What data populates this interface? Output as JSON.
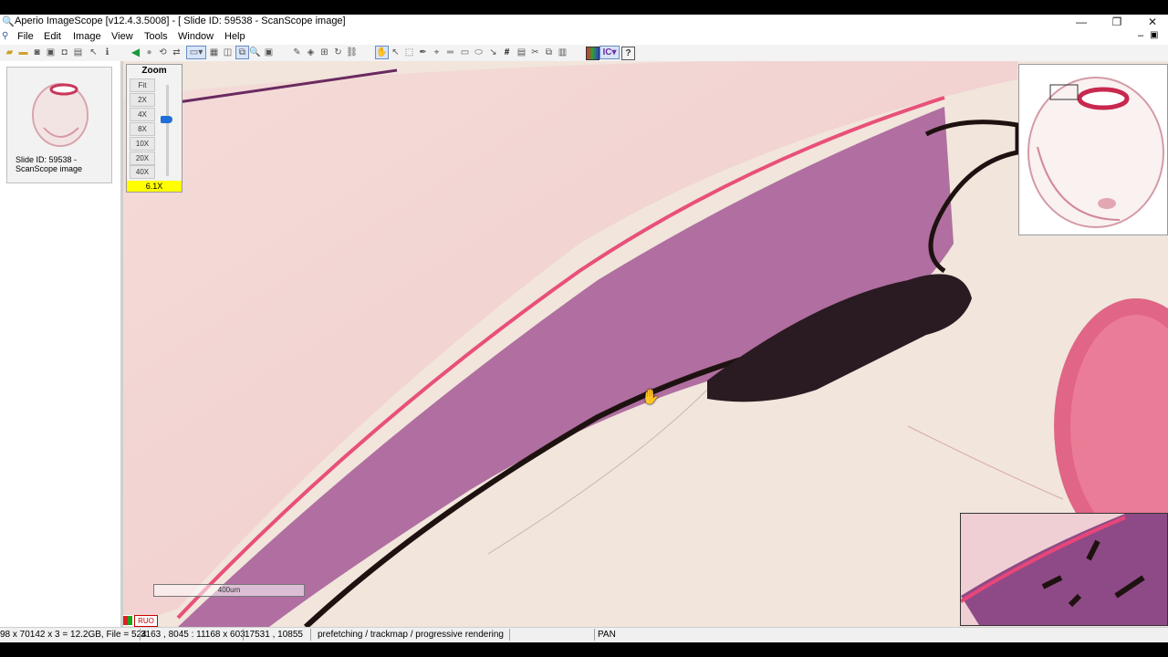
{
  "window": {
    "title": "Aperio ImageScope [v12.4.3.5008] - [ Slide ID: 59538 - ScanScope image]",
    "minimize": "—",
    "maximize": "❐",
    "close": "✕",
    "child_minimize": "–",
    "child_restore": "▣",
    "child_close": "✕"
  },
  "menu": [
    "File",
    "Edit",
    "Image",
    "View",
    "Tools",
    "Window",
    "Help"
  ],
  "toolbar_icons": [
    "open-icon",
    "folder-icon",
    "camera-icon",
    "save-icon",
    "export-icon",
    "network-icon",
    "arrow-icon",
    "info-icon",
    "back-icon",
    "forward-icon",
    "rotate-icon",
    "flip-icon",
    "select-dropdown-icon",
    "stack-icon",
    "split-icon",
    "sync-icon",
    "magnify-icon",
    "overview-icon",
    "annotation-pen-icon",
    "layers-icon",
    "filter-icon",
    "refresh-icon",
    "link-icon",
    "hand-pan-icon",
    "select-arrow-icon",
    "region-icon",
    "pen-icon",
    "measure-icon",
    "ruler-icon",
    "rectangle-icon",
    "ellipse-icon",
    "arrow-draw-icon",
    "grid-hash-icon",
    "table-icon",
    "cut-icon",
    "copy-icon",
    "paste-icon",
    "color-icon",
    "color-dropdown-icon",
    "help-icon"
  ],
  "left_panel": {
    "thumbnail_label": "Slide ID: 59538 - ScanScope image"
  },
  "zoom": {
    "title": "Zoom",
    "levels": [
      "Fit",
      "2X",
      "4X",
      "8X",
      "10X",
      "20X",
      "40X"
    ],
    "current": "6.1X"
  },
  "scale_bar": "400um",
  "ruo_label": "RUO",
  "status": {
    "dimensions": "98 x 70142 x 3 = 12.2GB, File = 524",
    "coords": "3163 , 8045 : 11168 x 603",
    "coords2": "17531 , 10855",
    "rendering": "prefetching / trackmap / progressive rendering",
    "mode": "PAN"
  },
  "colors": {
    "tissue_pink": "#e2708a",
    "stroma": "#8a3f7a",
    "pigment": "#1e1210",
    "background": "#f0e3d9",
    "zoom_highlight": "#ffff00"
  }
}
